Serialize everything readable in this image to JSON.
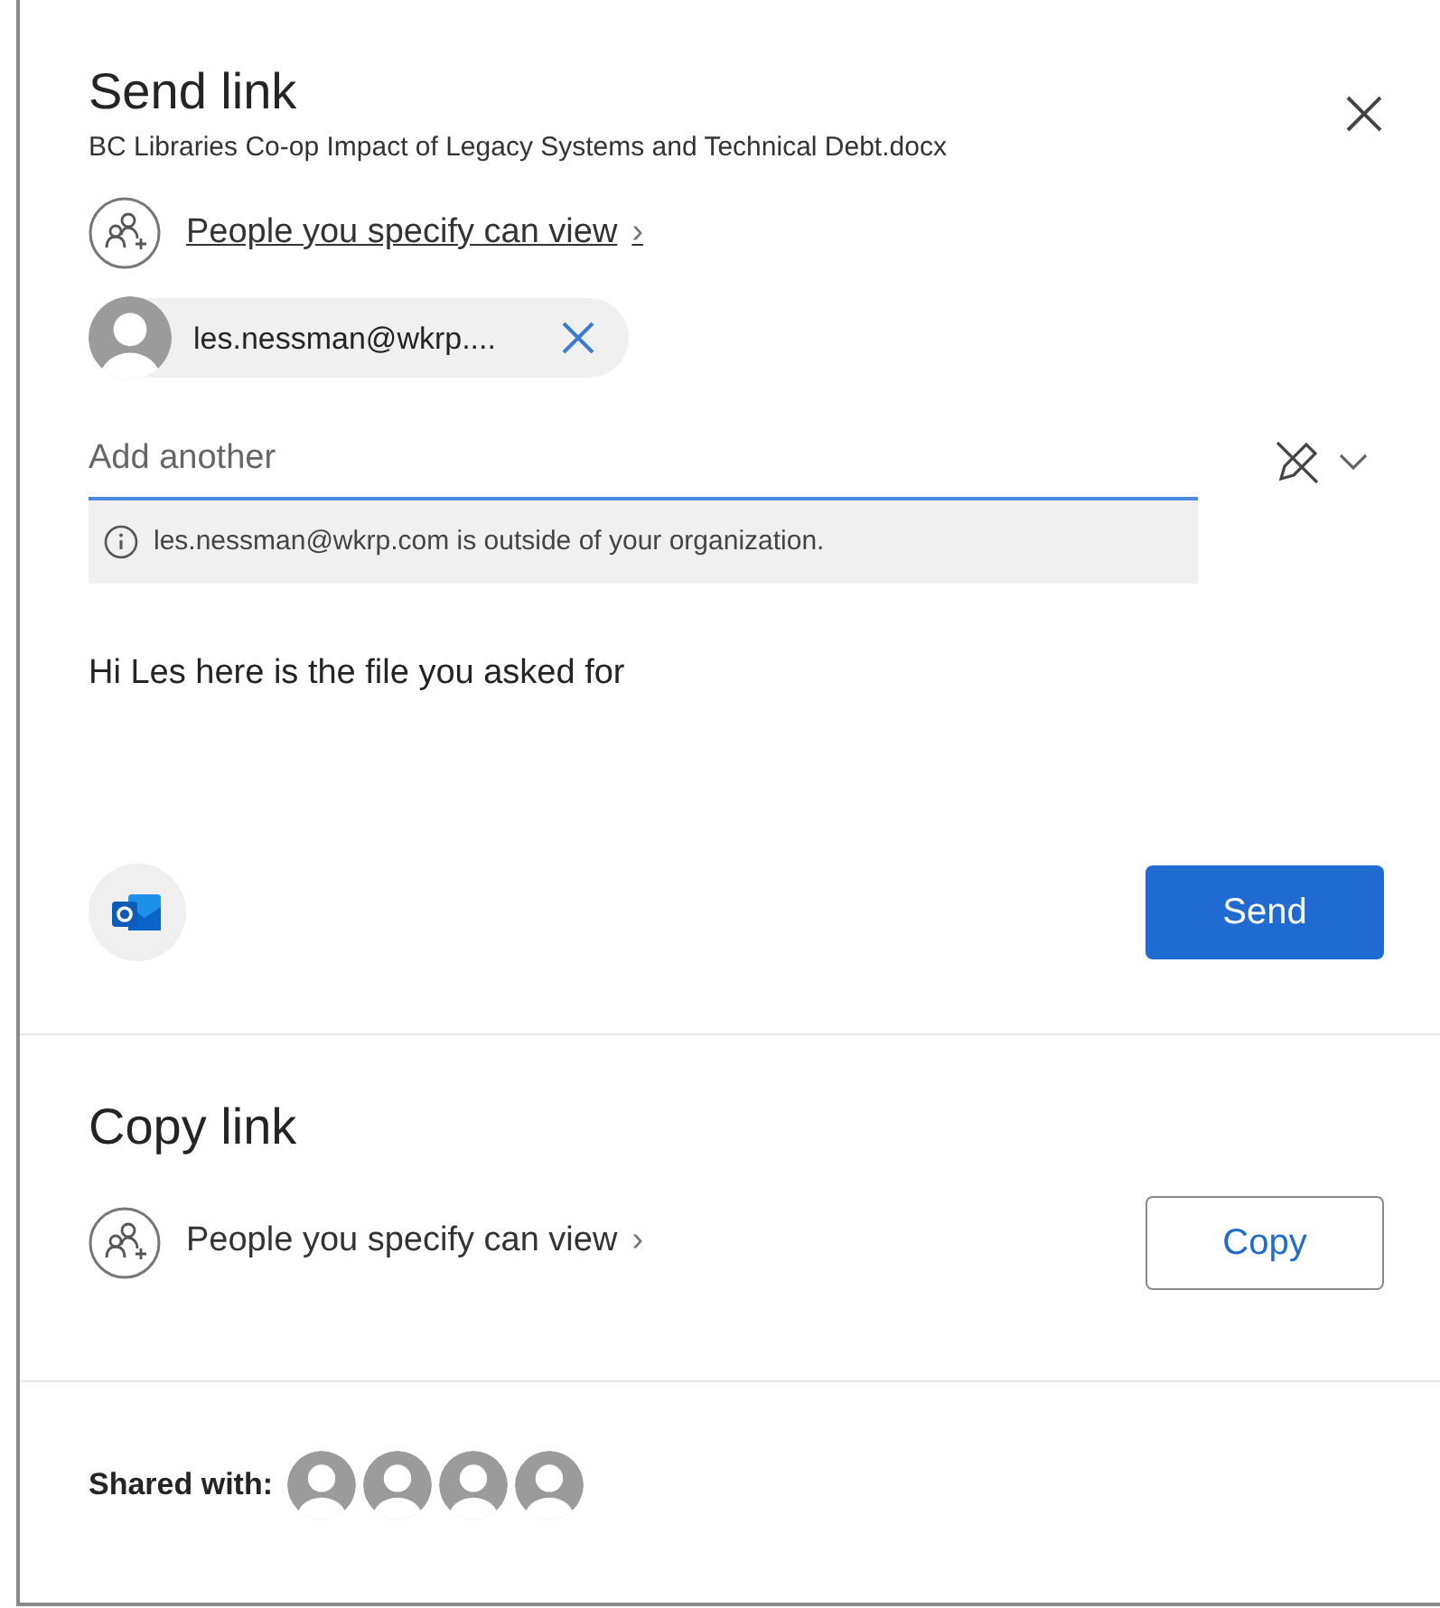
{
  "send_link": {
    "title": "Send link",
    "file_name": "BC Libraries Co-op Impact of Legacy Systems and Technical Debt.docx",
    "permission": {
      "label": "People you specify can view",
      "chevron": "›",
      "underlined": true
    },
    "recipients": [
      {
        "label": "les.nessman@wkrp...."
      }
    ],
    "add_field": {
      "placeholder": "Add another"
    },
    "notice": "les.nessman@wkrp.com is outside of your organization.",
    "message": "Hi Les here is the file you asked for",
    "send_button": "Send"
  },
  "copy_link": {
    "title": "Copy link",
    "permission": {
      "label": "People you specify can view",
      "chevron": "›",
      "underlined": false
    },
    "copy_button": "Copy"
  },
  "shared_with": {
    "label": "Shared with:",
    "avatars": [
      {
        "kind": "person"
      },
      {
        "kind": "person"
      },
      {
        "kind": "person"
      },
      {
        "kind": "person"
      }
    ]
  }
}
